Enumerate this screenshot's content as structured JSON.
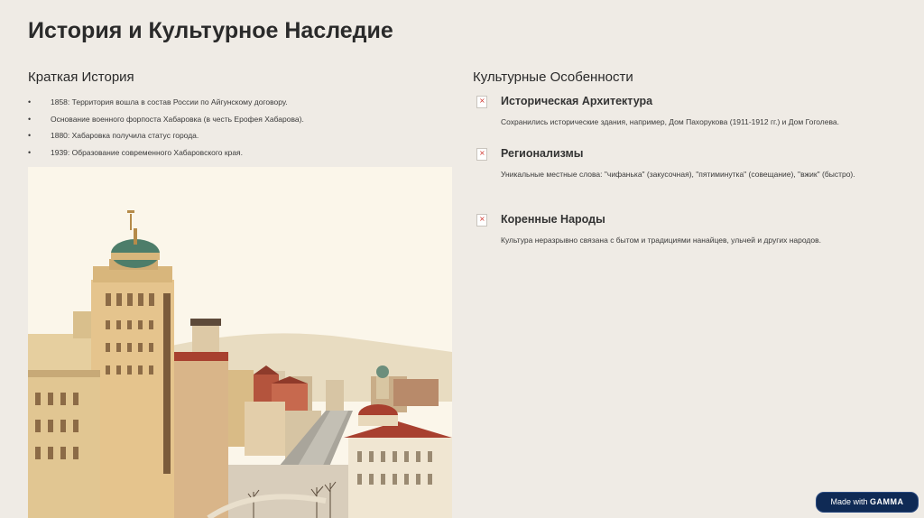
{
  "slide": {
    "title": "История и Культурное Наследие"
  },
  "history": {
    "heading": "Краткая История",
    "bullet_symbol": "•",
    "items": [
      "1858: Территория вошла в состав России по Айгунскому договору.",
      "Основание военного форпоста Хабаровка (в честь Ерофея Хабарова).",
      "1880: Хабаровка получила статус города.",
      "1939: Образование современного Хабаровского края."
    ]
  },
  "culture": {
    "heading": "Культурные Особенности",
    "features": [
      {
        "title": "Историческая Архитектура",
        "text": "Сохранились исторические здания, например, Дом Пахорукова (1911-1912 гг.) и Дом Гоголева.",
        "icon": "broken-image-icon"
      },
      {
        "title": "Регионализмы",
        "text": "Уникальные местные слова: \"чифанька\" (закусочная), \"пятиминутка\" (совещание), \"вжик\" (быстро).",
        "icon": "broken-image-icon"
      },
      {
        "title": "Коренные Народы",
        "text": "Культура неразрывно связана с бытом и традициями нанайцев, ульчей и других народов.",
        "icon": "broken-image-icon"
      }
    ]
  },
  "badge": {
    "prefix": "Made with",
    "brand": "GAMMA"
  },
  "colors": {
    "background": "#efebe5",
    "dome_green": "#4d7d6a",
    "roof_red": "#a8402f",
    "building_tan": "#e2c79a",
    "badge_bg": "#0f2a55"
  }
}
